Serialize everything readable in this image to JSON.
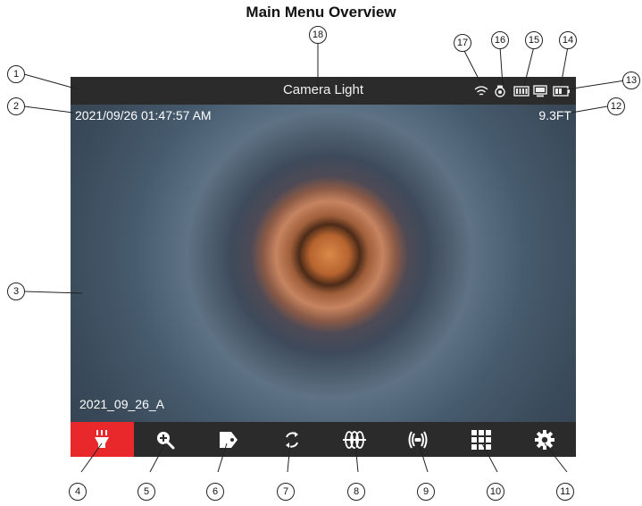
{
  "title": "Main Menu Overview",
  "screen": {
    "topbar_label": "Camera Light",
    "timestamp": "2021/09/26 01:47:57 AM",
    "distance": "9.3FT",
    "file_name": "2021_09_26_A",
    "status_icons": [
      "wifi-icon",
      "sd-card-icon",
      "camera-battery-icon",
      "monitor-icon",
      "battery-icon"
    ],
    "toolbar": [
      {
        "name": "camera-light-icon",
        "active": true
      },
      {
        "name": "zoom-icon",
        "active": false
      },
      {
        "name": "tag-icon",
        "active": false
      },
      {
        "name": "rotate-icon",
        "active": false
      },
      {
        "name": "sonde-icon",
        "active": false
      },
      {
        "name": "locator-icon",
        "active": false
      },
      {
        "name": "grid-icon",
        "active": false
      },
      {
        "name": "settings-icon",
        "active": false
      }
    ],
    "accent_color": "#e8282a"
  },
  "callouts": [
    "1",
    "2",
    "3",
    "4",
    "5",
    "6",
    "7",
    "8",
    "9",
    "10",
    "11",
    "12",
    "13",
    "14",
    "15",
    "16",
    "17",
    "18"
  ]
}
